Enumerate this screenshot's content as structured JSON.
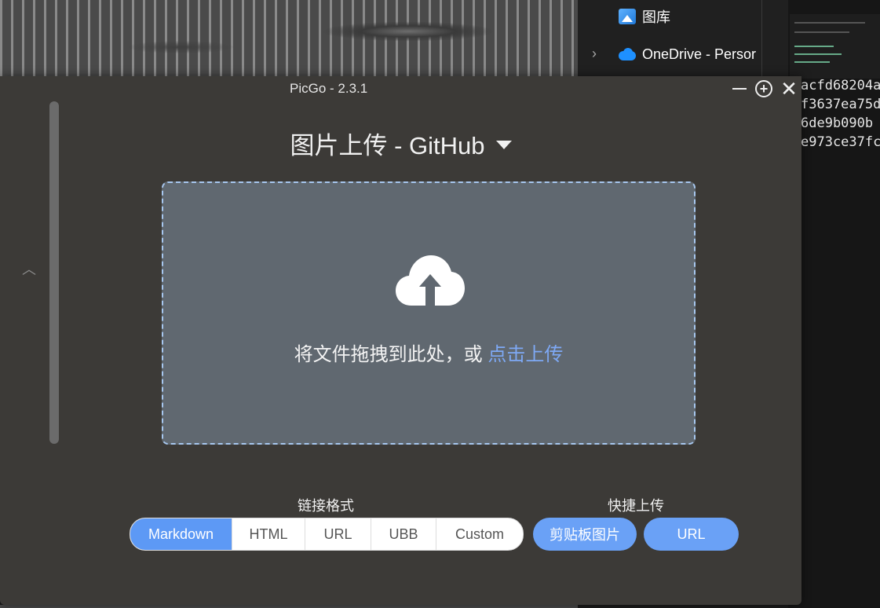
{
  "background": {
    "explorer": {
      "items": [
        "图库",
        "OneDrive - Persor"
      ]
    },
    "editor": {
      "hash_lines": [
        "acfd68204a",
        "f3637ea75d",
        "6de9b090b",
        "e973ce37fc"
      ]
    }
  },
  "window": {
    "title": "PicGo - 2.3.1",
    "controls": {
      "minimize": "—",
      "plus": "+",
      "close": "✕"
    }
  },
  "upload": {
    "heading": "图片上传 - GitHub",
    "drop_text": "将文件拖拽到此处，或 ",
    "drop_link": "点击上传"
  },
  "link_format": {
    "label": "链接格式",
    "options": [
      "Markdown",
      "HTML",
      "URL",
      "UBB",
      "Custom"
    ],
    "selected": "Markdown"
  },
  "quick_upload": {
    "label": "快捷上传",
    "buttons": [
      "剪贴板图片",
      "URL"
    ]
  },
  "colors": {
    "accent": "#5d99f5",
    "window_bg": "#3c3a37",
    "dropzone_bg": "#606870",
    "link": "#7ea9f5"
  }
}
